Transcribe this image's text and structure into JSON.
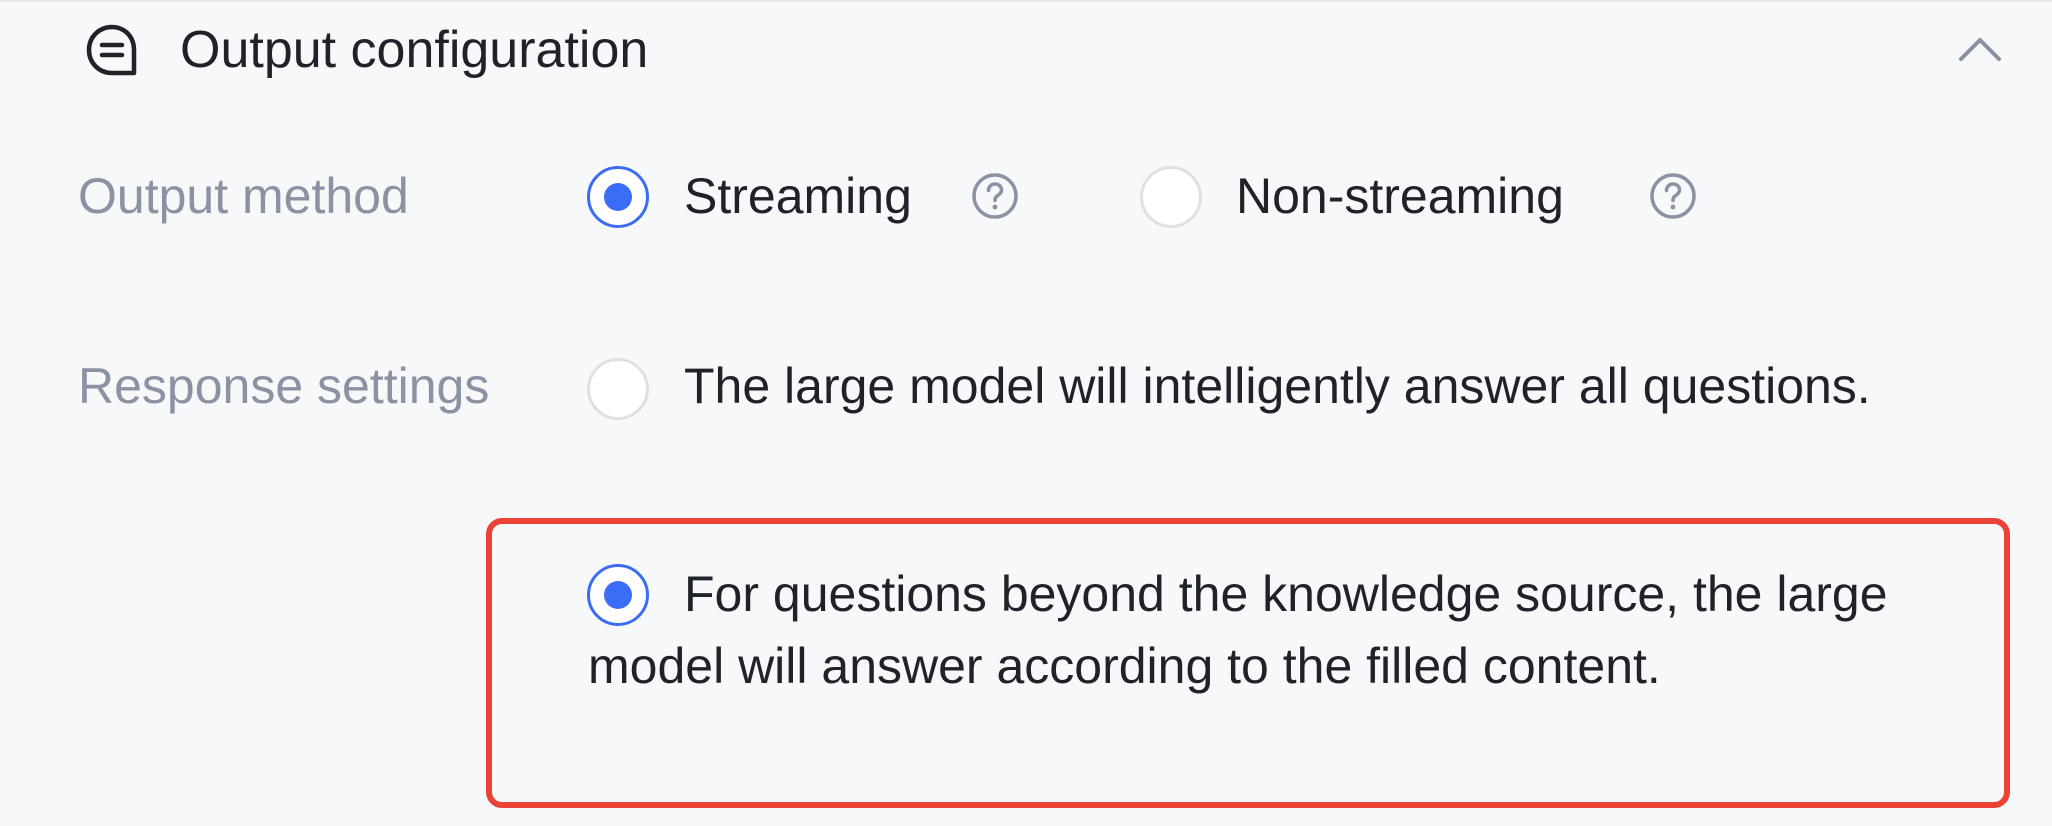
{
  "section": {
    "title": "Output configuration",
    "icon": "chat-bubble-icon",
    "collapse_icon": "chevron-up-icon"
  },
  "output_method": {
    "label": "Output method",
    "options": [
      {
        "label": "Streaming",
        "selected": true,
        "help_icon": "question-circle-icon"
      },
      {
        "label": "Non-streaming",
        "selected": false,
        "help_icon": "question-circle-icon"
      }
    ]
  },
  "response_settings": {
    "label": "Response settings",
    "options": [
      {
        "label": "The large model will intelligently answer all questions.",
        "selected": false
      },
      {
        "label": "For questions beyond the knowledge source, the large model will answer according to the filled content.",
        "selected": true
      }
    ]
  },
  "colors": {
    "accent": "#3b6cf6",
    "highlight": "#ea4336",
    "label": "#8a92a3",
    "text": "#1f2329",
    "background": "#f7f8fa"
  }
}
